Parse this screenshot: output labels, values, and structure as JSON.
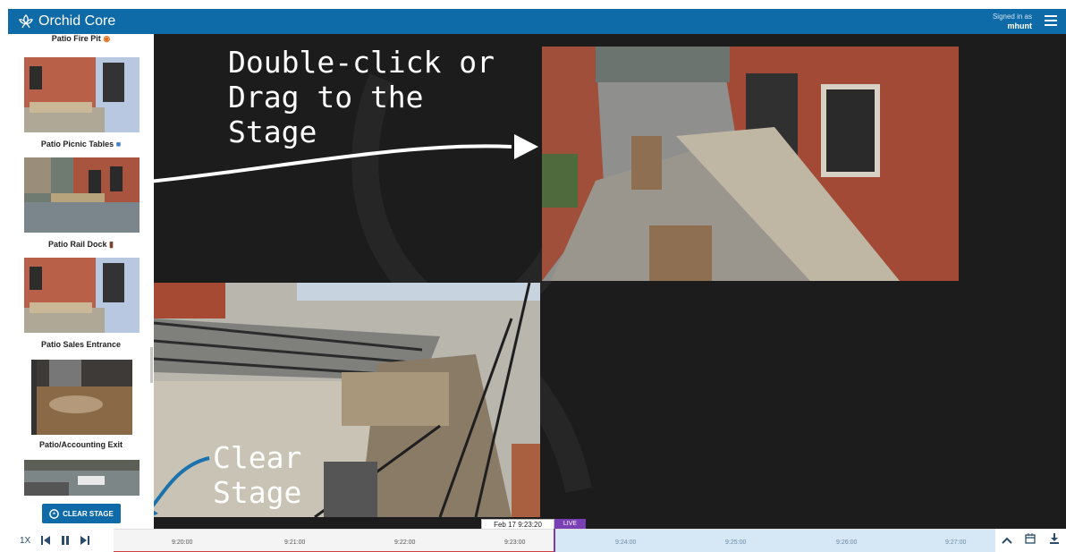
{
  "app": {
    "title": "Orchid Core",
    "signed_in_label": "Signed in as",
    "username": "mhunt",
    "accent": "#0f6aa8"
  },
  "sidebar": {
    "cameras": [
      {
        "label": "Patio Fire Pit",
        "icon": "fire-emoji-icon"
      },
      {
        "label": "Patio Picnic Tables",
        "icon": "shield-emoji-icon"
      },
      {
        "label": "Patio Rail Dock",
        "icon": "truck-emoji-icon"
      },
      {
        "label": "Patio Sales Entrance"
      },
      {
        "label": "Patio/Accounting Exit"
      },
      {
        "label": ""
      }
    ],
    "clear_stage_label": "CLEAR STAGE"
  },
  "annotations": {
    "drag_hint": [
      "Double-click or",
      "Drag to the",
      "Stage"
    ],
    "clear_hint": [
      "Clear",
      "Stage"
    ]
  },
  "playback": {
    "speed": "1X",
    "timestamp": "Feb 17 9:23:20",
    "live_label": "LIVE",
    "ticks": [
      "9:20:00",
      "9:21:00",
      "9:22:00",
      "9:23:00",
      "9:24:00",
      "9:25:00",
      "9:26:00",
      "9:27:00"
    ],
    "live_color": "#7a3fb5"
  }
}
